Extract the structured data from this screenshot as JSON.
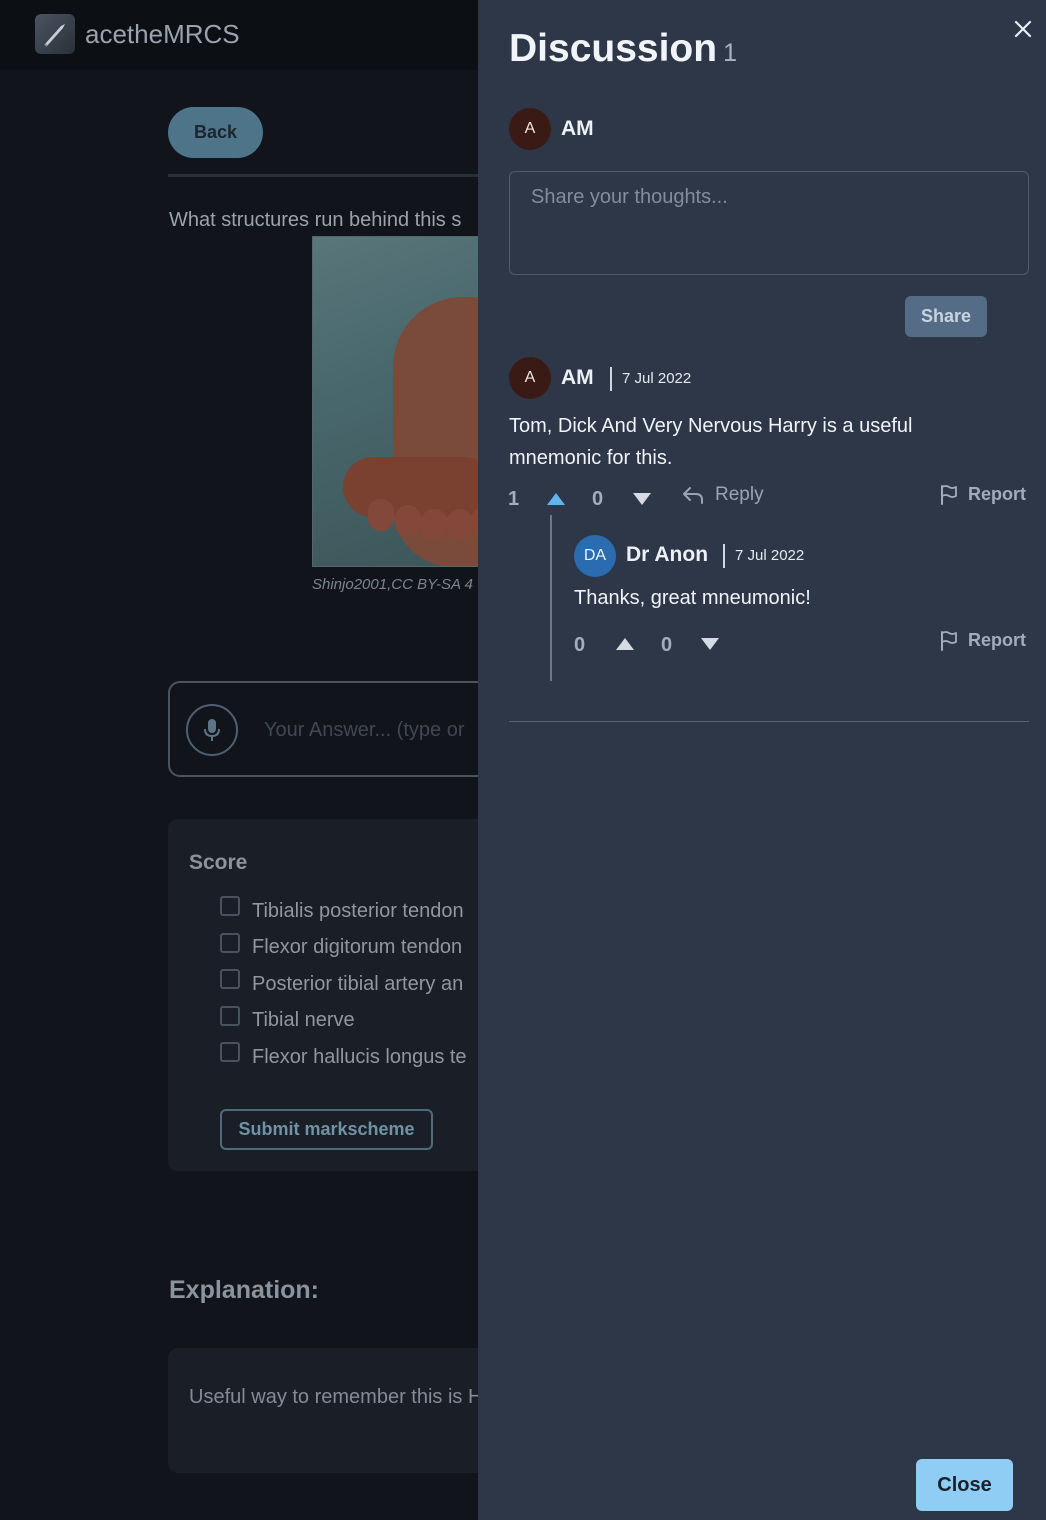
{
  "app": {
    "brand": "acetheMRCS",
    "logo_icon": "scalpel-icon"
  },
  "page": {
    "back_label": "Back",
    "question": "What structures run behind this s",
    "image_caption": "Shinjo2001,CC BY-SA 4",
    "answer_placeholder": "Your Answer... (type or",
    "score": {
      "title": "Score",
      "items": [
        {
          "label": "Tibialis posterior tendon",
          "checked": false
        },
        {
          "label": "Flexor digitorum tendon",
          "checked": false
        },
        {
          "label": "Posterior tibial artery an",
          "checked": false
        },
        {
          "label": "Tibial nerve",
          "checked": false
        },
        {
          "label": "Flexor hallucis longus te",
          "checked": false
        }
      ],
      "submit_label": "Submit markscheme"
    },
    "explanation": {
      "title": "Explanation:",
      "text": "Useful way to remember this is Harry"
    }
  },
  "drawer": {
    "title": "Discussion",
    "count": "1",
    "current_user": {
      "initial": "A",
      "name": "AM"
    },
    "input_placeholder": "Share your thoughts...",
    "share_label": "Share",
    "comment": {
      "avatar": "A",
      "author": "AM",
      "date": "7 Jul 2022",
      "body": "Tom, Dick And Very Nervous Harry is a useful mnemonic for this.",
      "upvotes": "1",
      "downvotes": "0",
      "reply_label": "Reply",
      "report_label": "Report",
      "reply": {
        "avatar": "DA",
        "author": "Dr Anon",
        "date": "7 Jul 2022",
        "body": "Thanks, great mneumonic!",
        "upvotes": "0",
        "downvotes": "0",
        "report_label": "Report"
      }
    },
    "close_label": "Close"
  },
  "colors": {
    "drawer_bg": "#2d3748",
    "page_bg": "#11141b",
    "accent": "#90cdf4",
    "upvote_active": "#63b3ed",
    "reply_avatar": "#2b6cb0"
  }
}
